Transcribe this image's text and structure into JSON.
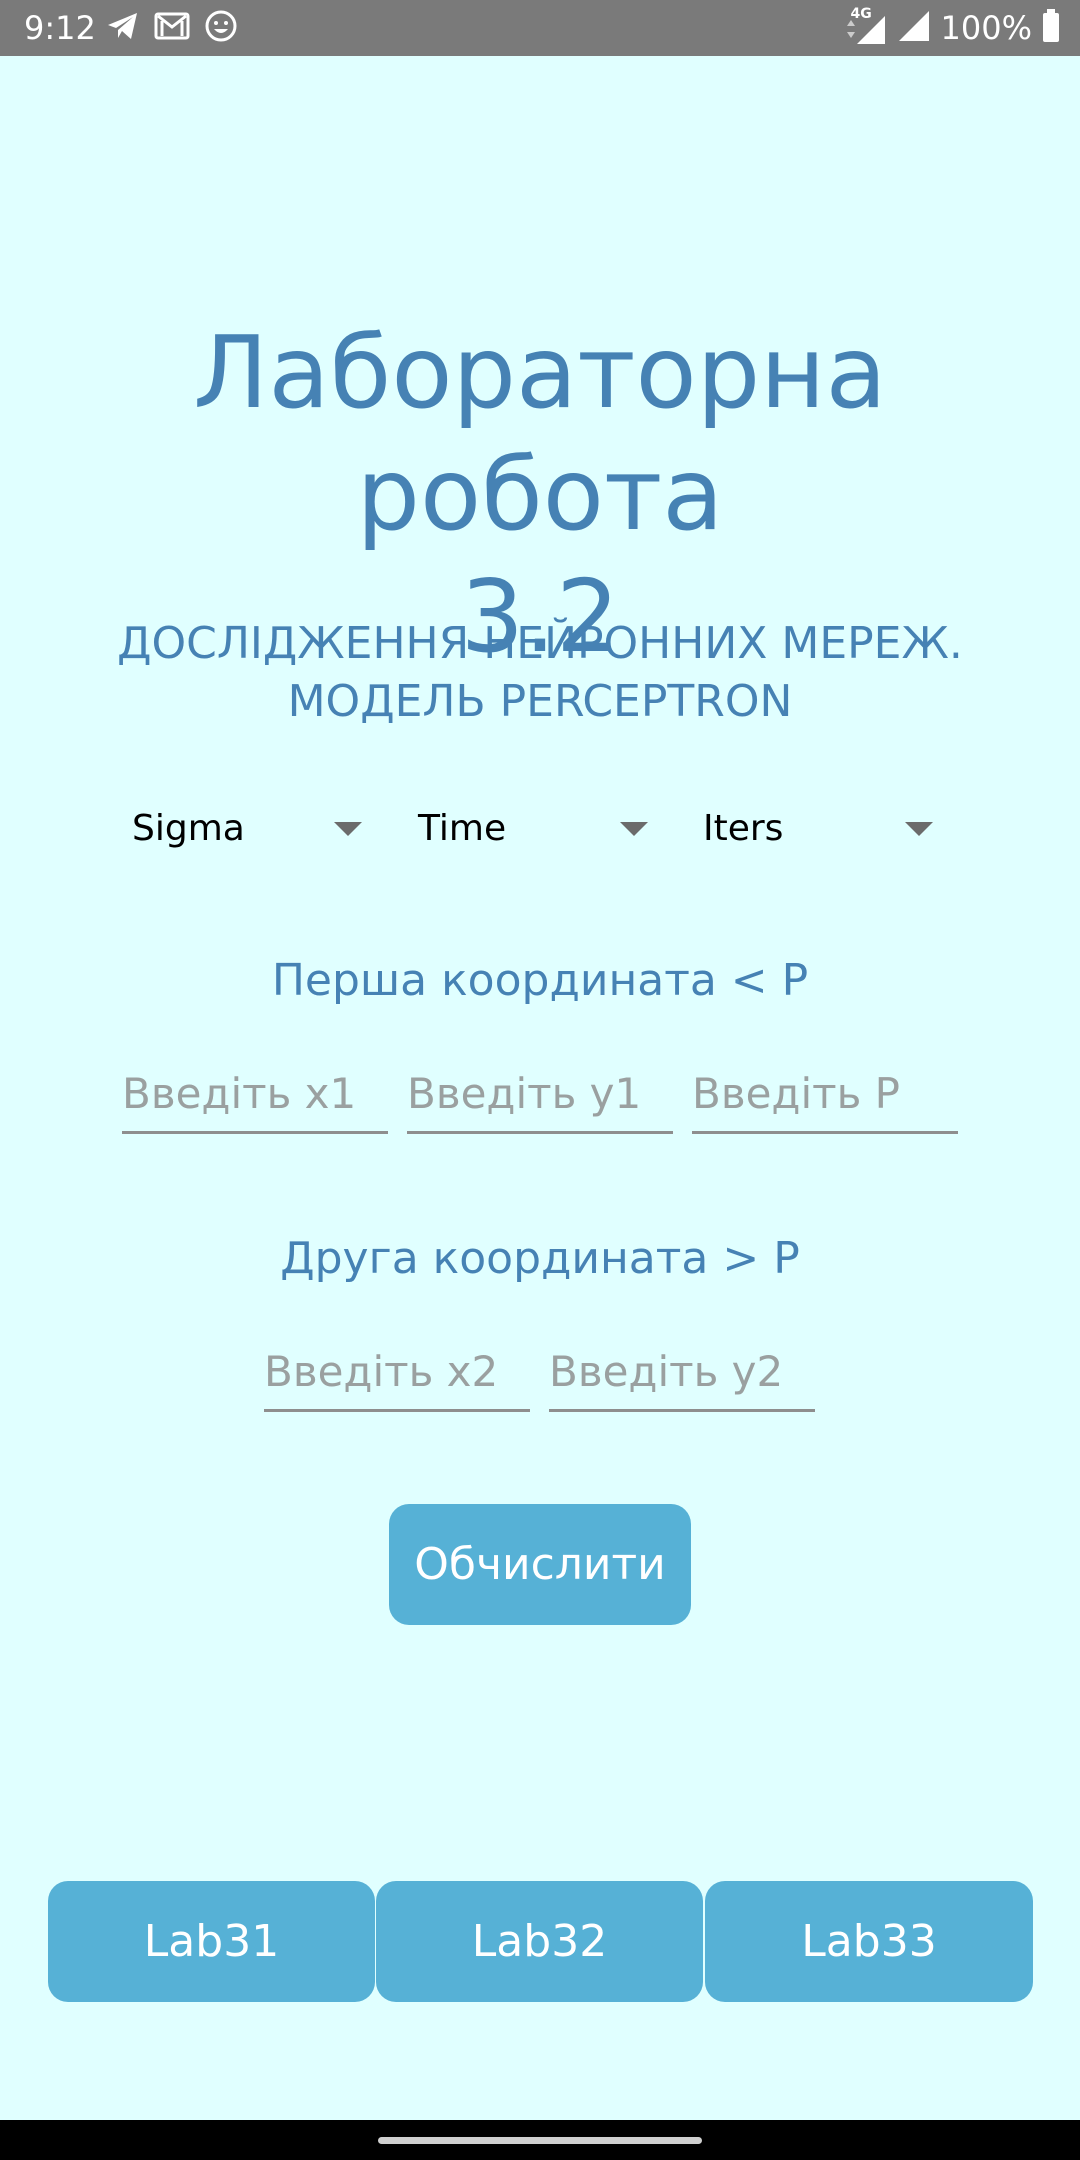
{
  "status_bar": {
    "time": "9:12",
    "network_label": "4G",
    "battery_text": "100%",
    "icons_left": [
      "telegram-icon",
      "gmail-icon",
      "emoji-icon"
    ],
    "icons_right": [
      "data-arrows-icon",
      "signal-icon",
      "signal-icon",
      "battery-icon"
    ]
  },
  "title": {
    "line1": "Лабораторна робота",
    "line2": "3.2"
  },
  "subtitle": {
    "line1": "ДОСЛІДЖЕННЯ НЕЙРОННИХ МЕРЕЖ.",
    "line2": "МОДЕЛЬ PERCEPTRON"
  },
  "spinners": [
    {
      "label": "Sigma"
    },
    {
      "label": "Time"
    },
    {
      "label": "Iters"
    }
  ],
  "first_section": {
    "label": "Перша координата < P",
    "inputs": [
      {
        "placeholder": "Введіть x1",
        "value": ""
      },
      {
        "placeholder": "Введіть y1",
        "value": ""
      },
      {
        "placeholder": "Введіть P",
        "value": ""
      }
    ]
  },
  "second_section": {
    "label": "Друга координата > P",
    "inputs": [
      {
        "placeholder": "Введіть x2",
        "value": ""
      },
      {
        "placeholder": "Введіть y2",
        "value": ""
      }
    ]
  },
  "calculate_button": {
    "label": "Обчислити"
  },
  "bottom_nav": [
    {
      "label": "Lab31"
    },
    {
      "label": "Lab32"
    },
    {
      "label": "Lab33"
    }
  ],
  "colors": {
    "background": "#e0ffff",
    "accent_text": "#4682b4",
    "button": "#56b1d6",
    "status_bar": "#7a7a7a"
  }
}
